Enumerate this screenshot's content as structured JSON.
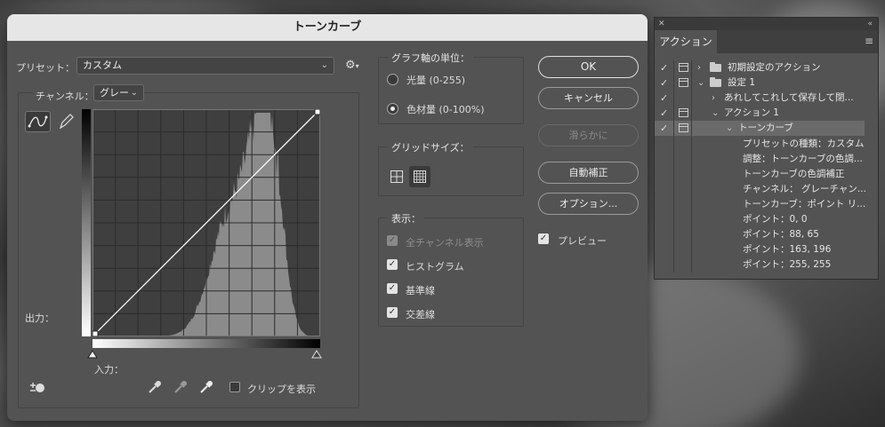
{
  "dialog": {
    "title": "トーンカーブ",
    "preset_label": "プリセット：",
    "preset_value": "カスタム",
    "channel_label": "チャンネル：",
    "channel_value": "グレー",
    "output_label": "出力：",
    "input_label": "入力：",
    "clip_label": "クリップを表示",
    "graph_unit": {
      "title": "グラフ軸の単位：",
      "options": [
        "光量 (0-255)",
        "色材量 (0-100%)"
      ],
      "selected_index": 1
    },
    "grid_size": {
      "title": "グリッドサイズ：",
      "selected": "fine"
    },
    "display": {
      "title": "表示：",
      "options": [
        {
          "label": "全チャンネル表示",
          "checked": true,
          "enabled": false
        },
        {
          "label": "ヒストグラム",
          "checked": true,
          "enabled": true
        },
        {
          "label": "基準線",
          "checked": true,
          "enabled": true
        },
        {
          "label": "交差線",
          "checked": true,
          "enabled": true
        }
      ]
    },
    "buttons": {
      "ok": "OK",
      "cancel": "キャンセル",
      "smooth": "滑らかに",
      "auto": "自動補正",
      "options": "オプション..."
    },
    "preview": {
      "label": "プレビュー",
      "checked": true
    }
  },
  "curve": {
    "points": [
      [
        0,
        0
      ],
      [
        255,
        255
      ]
    ]
  },
  "actions_panel": {
    "tab": "アクション",
    "rows": [
      {
        "text": "初期設定のアクション",
        "check": true,
        "dialog": true,
        "twirl": "closed",
        "folder": true,
        "level": 0
      },
      {
        "text": "設定 1",
        "check": true,
        "dialog": true,
        "twirl": "open",
        "folder": true,
        "level": 0
      },
      {
        "text": "あれしてこれして保存して閉...",
        "check": true,
        "dialog": false,
        "twirl": "closed",
        "folder": false,
        "level": 1
      },
      {
        "text": "アクション 1",
        "check": true,
        "dialog": true,
        "twirl": "open",
        "folder": false,
        "level": 1
      },
      {
        "text": "トーンカーブ",
        "check": true,
        "dialog": true,
        "twirl": "open",
        "folder": false,
        "level": 2,
        "highlight": true
      },
      {
        "text": "プリセットの種類：カスタム",
        "level": 3
      },
      {
        "text": "調整：トーンカーブの色調...",
        "level": 3
      },
      {
        "text": "トーンカーブの色調補正",
        "level": 3
      },
      {
        "text": "チャンネル： グレーチャン...",
        "level": 3
      },
      {
        "text": "トーンカーブ：ポイント リ...",
        "level": 3
      },
      {
        "text": "ポイント：0, 0",
        "level": 3
      },
      {
        "text": "ポイント：88, 65",
        "level": 3
      },
      {
        "text": "ポイント：163, 196",
        "level": 3
      },
      {
        "text": "ポイント：255, 255",
        "level": 3
      }
    ]
  }
}
